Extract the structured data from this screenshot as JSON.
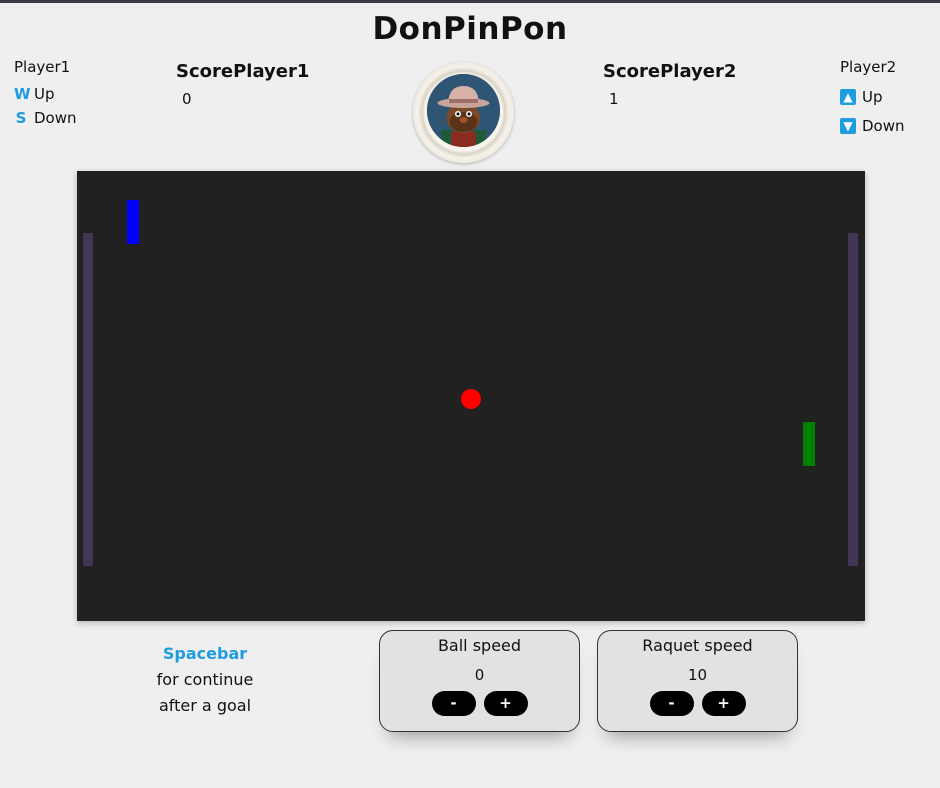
{
  "title": "DonPinPon",
  "player1": {
    "label": "Player1",
    "up_key": "W",
    "up_label": "Up",
    "down_key": "S",
    "down_label": "Down"
  },
  "player2": {
    "label": "Player2",
    "up_key_icon": "arrow-up-icon",
    "up_label": "Up",
    "down_key_icon": "arrow-down-icon",
    "down_label": "Down"
  },
  "score1": {
    "label": "ScorePlayer1",
    "value": "0"
  },
  "score2": {
    "label": "ScorePlayer2",
    "value": "1"
  },
  "court": {
    "background": "#212121",
    "paddle_left_color": "#0000ff",
    "paddle_right_color": "#008000",
    "ball_color": "#ff0000"
  },
  "hint": {
    "key": "Spacebar",
    "line1": "for continue",
    "line2": "after a goal"
  },
  "ball_speed": {
    "title": "Ball speed",
    "value": "0",
    "minus": "-",
    "plus": "+"
  },
  "raquet_speed": {
    "title": "Raquet speed",
    "value": "10",
    "minus": "-",
    "plus": "+"
  }
}
